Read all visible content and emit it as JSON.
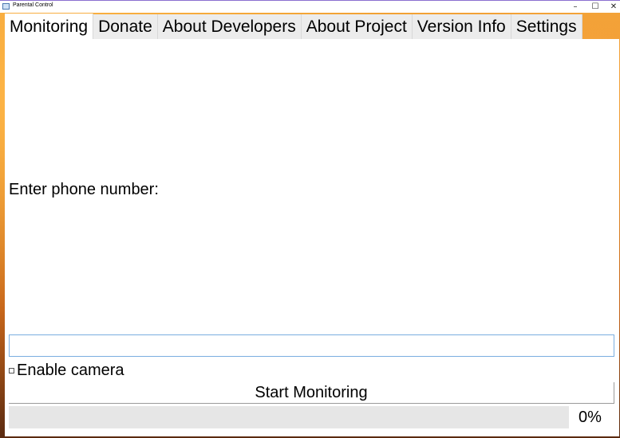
{
  "window": {
    "title": "Parental Control",
    "minimize": "–",
    "maximize": "☐",
    "close": "✕"
  },
  "tabs": [
    {
      "label": "Monitoring",
      "active": true
    },
    {
      "label": "Donate",
      "active": false
    },
    {
      "label": "About Developers",
      "active": false
    },
    {
      "label": "About Project",
      "active": false
    },
    {
      "label": "Version Info",
      "active": false
    },
    {
      "label": "Settings",
      "active": false
    }
  ],
  "monitoring": {
    "phone_label": "Enter phone number:",
    "phone_value": "",
    "camera_label": "Enable camera",
    "camera_checked": false,
    "start_button": "Start Monitoring",
    "progress_value": 0,
    "progress_text": "0%"
  },
  "colors": {
    "input_border": "#7aaee0",
    "progress_track": "#e6e6e6",
    "background_accent": "#e38a22"
  }
}
